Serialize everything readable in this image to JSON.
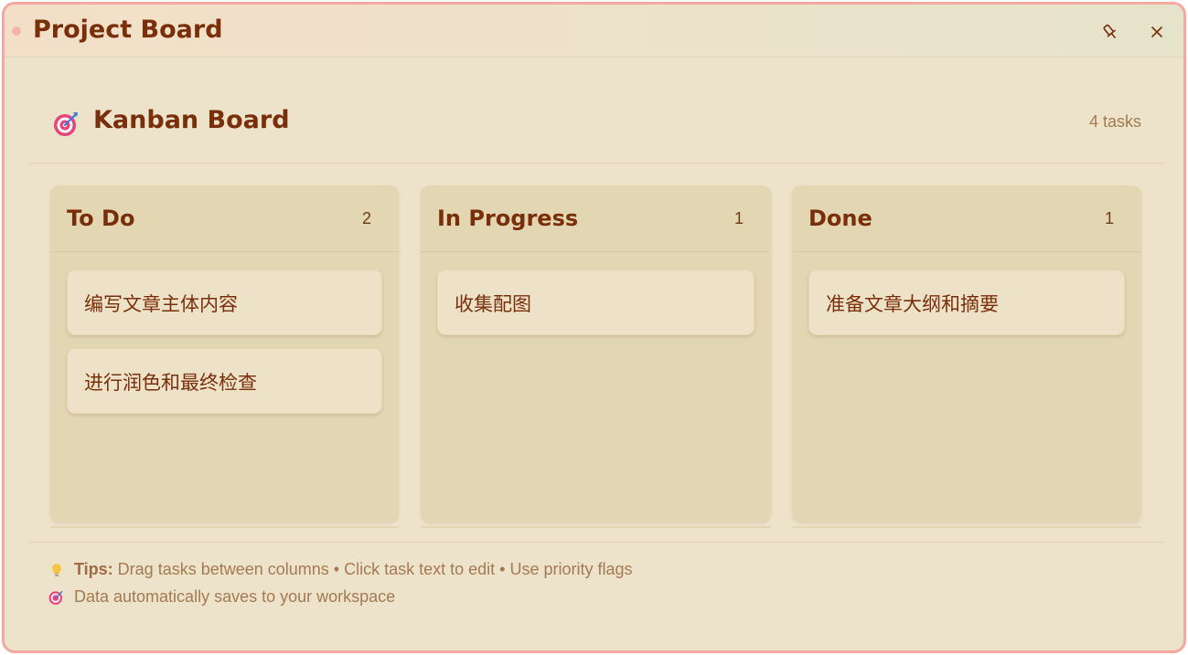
{
  "window": {
    "title": "Project Board",
    "pin_icon": "pin-icon",
    "close_icon": "close-icon"
  },
  "board": {
    "icon": "target-icon",
    "title": "Kanban Board",
    "task_count": "4 tasks"
  },
  "columns": [
    {
      "title": "To Do",
      "count": "2",
      "cards": [
        "编写文章主体内容",
        "进行润色和最终检查"
      ]
    },
    {
      "title": "In Progress",
      "count": "1",
      "cards": [
        "收集配图"
      ]
    },
    {
      "title": "Done",
      "count": "1",
      "cards": [
        "准备文章大纲和摘要"
      ]
    }
  ],
  "footer": {
    "tips_label": "Tips:",
    "tips_text": "Drag tasks between columns • Click task text to edit • Use priority flags",
    "save_text": "Data automatically saves to your workspace"
  },
  "colors": {
    "accent": "#7a2f0b",
    "background": "#ede2ca",
    "column": "#e3d6b3",
    "card": "#ede1c7",
    "window_border": "#f4a8a0",
    "muted_text": "#a47a52"
  }
}
